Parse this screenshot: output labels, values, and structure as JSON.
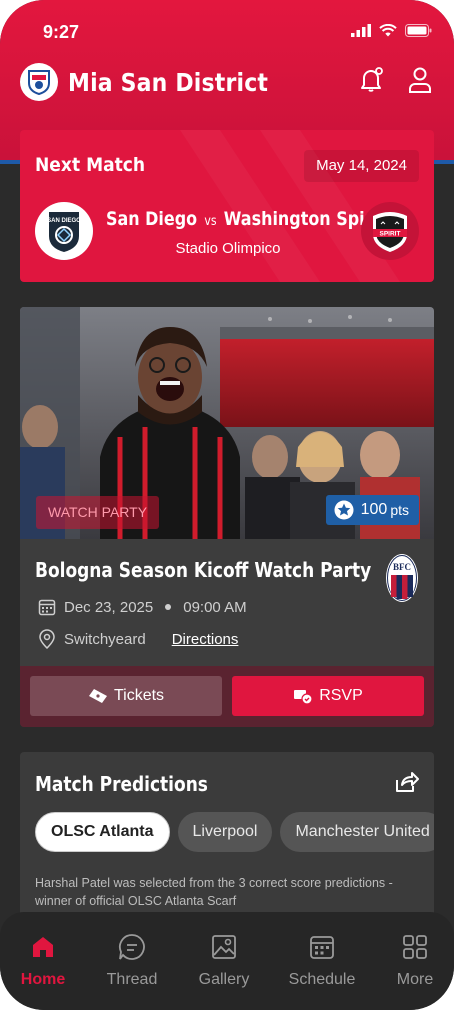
{
  "status": {
    "time": "9:27"
  },
  "app": {
    "title": "Mia San District"
  },
  "next_match": {
    "label": "Next Match",
    "date": "May 14, 2024",
    "home_team": "San Diego",
    "vs": "vs",
    "away_team": "Washington Spirit",
    "stadium": "Stadio Olimpico",
    "home_logo_text": "SAN DIEGO",
    "away_logo_text": "SPIRIT"
  },
  "event": {
    "badge": "WATCH PARTY",
    "points": "100",
    "points_unit": "pts",
    "title": "Bologna Season Kicoff Watch Party",
    "date": "Dec 23, 2025",
    "time": "09:00 AM",
    "location": "Switchyeard",
    "directions": "Directions",
    "tickets_label": "Tickets",
    "rsvp_label": "RSVP",
    "club_logo_text": "BFC"
  },
  "predictions": {
    "title": "Match Predictions",
    "chips": [
      "OLSC Atlanta",
      "Liverpool",
      "Manchester United"
    ],
    "active_chip": 0,
    "text": "Harshal Patel was selected from the 3 correct score predictions - winner of official OLSC Atlanta Scarf"
  },
  "tabs": [
    {
      "label": "Home",
      "icon": "home-icon",
      "active": true
    },
    {
      "label": "Thread",
      "icon": "chat-icon",
      "active": false
    },
    {
      "label": "Gallery",
      "icon": "image-icon",
      "active": false
    },
    {
      "label": "Schedule",
      "icon": "calendar-icon",
      "active": false
    },
    {
      "label": "More",
      "icon": "grid-icon",
      "active": false
    }
  ],
  "colors": {
    "brand_red": "#e0163f",
    "accent_blue": "#1f5fa6",
    "background": "#2b2b2b"
  }
}
